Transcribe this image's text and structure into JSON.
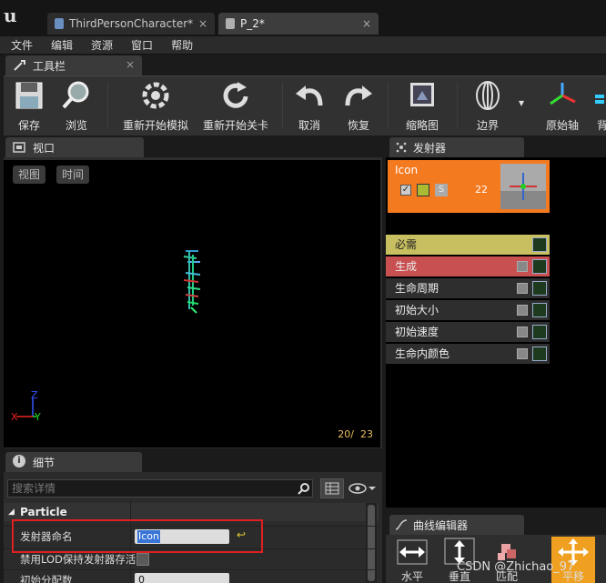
{
  "tabs": [
    {
      "label": "ThirdPersonCharacter*"
    },
    {
      "label": "P_2*"
    }
  ],
  "menu": [
    "文件",
    "编辑",
    "资源",
    "窗口",
    "帮助"
  ],
  "toolbar": {
    "title": "工具栏",
    "buttons": [
      {
        "label": "保存",
        "icon": "save-icon"
      },
      {
        "label": "浏览",
        "icon": "browse-icon"
      },
      {
        "label": "重新开始模拟",
        "icon": "restart-sim-icon"
      },
      {
        "label": "重新开始关卡",
        "icon": "restart-level-icon"
      },
      {
        "label": "取消",
        "icon": "undo-icon"
      },
      {
        "label": "恢复",
        "icon": "redo-icon"
      },
      {
        "label": "缩略图",
        "icon": "thumbnail-icon"
      },
      {
        "label": "边界",
        "icon": "bounds-icon"
      },
      {
        "label": "原始轴",
        "icon": "origin-axis-icon"
      },
      {
        "label": "背景",
        "icon": "background-icon"
      }
    ]
  },
  "viewport": {
    "title": "视口",
    "view_btn": "视图",
    "time_btn": "时间",
    "counter": "20/  23",
    "axis_x": "X",
    "axis_y": "Y",
    "axis_z": "Z"
  },
  "emitters": {
    "title": "发射器",
    "emitter_name": "Icon",
    "count": "22",
    "solo": "S",
    "modules": [
      {
        "label": "必需",
        "color": "#c8c060"
      },
      {
        "label": "生成",
        "color": "#c85050"
      },
      {
        "label": "生命周期",
        "color": "#2e2e2e"
      },
      {
        "label": "初始大小",
        "color": "#2e2e2e"
      },
      {
        "label": "初始速度",
        "color": "#2e2e2e"
      },
      {
        "label": "生命内颜色",
        "color": "#2e2e2e"
      }
    ]
  },
  "details": {
    "title": "细节",
    "search_placeholder": "搜索详情",
    "category": "Particle",
    "rows": [
      {
        "label": "发射器命名",
        "value": "Icon"
      },
      {
        "label": "禁用LOD保持发射器存活"
      },
      {
        "label": "初始分配数",
        "value": "0"
      }
    ]
  },
  "curve_editor": {
    "title": "曲线编辑器",
    "buttons": [
      "水平",
      "垂直",
      "匹配",
      "平移"
    ]
  },
  "watermark": "CSDN @Zhichao_97"
}
